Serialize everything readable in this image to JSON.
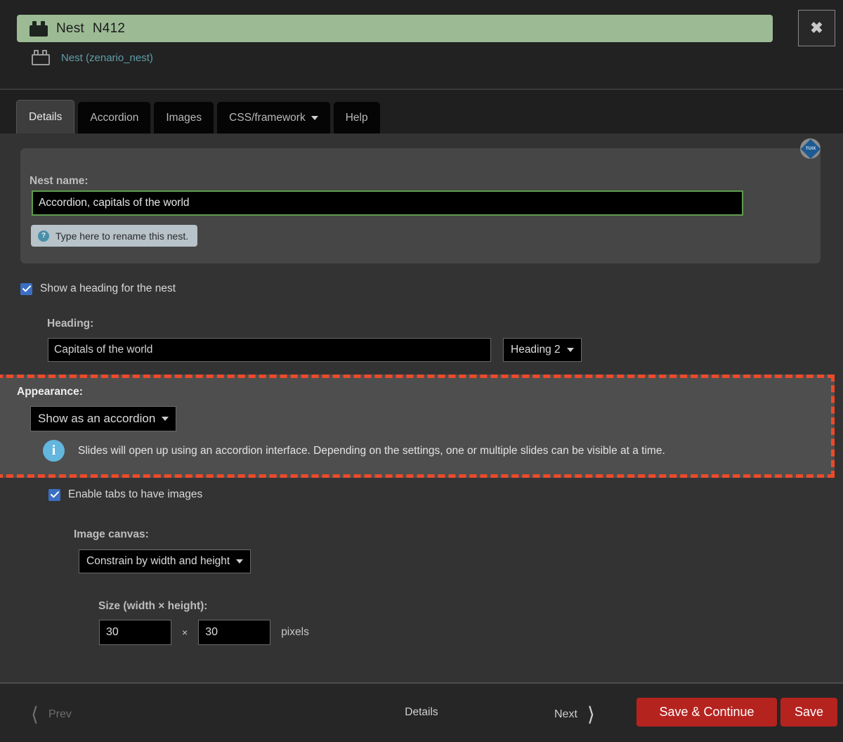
{
  "window": {
    "drag_handle": "drag-handle",
    "title": "Nest",
    "title_code": "N412",
    "close_label": "✖",
    "subtitle": "Nest (zenario_nest)"
  },
  "tabs": [
    {
      "label": "Details",
      "active": true,
      "has_caret": false
    },
    {
      "label": "Accordion",
      "active": false,
      "has_caret": false
    },
    {
      "label": "Images",
      "active": false,
      "has_caret": false
    },
    {
      "label": "CSS/framework",
      "active": false,
      "has_caret": true
    },
    {
      "label": "Help",
      "active": false,
      "has_caret": false
    }
  ],
  "panel": {
    "badge_text": "TUIX",
    "nest_name_label": "Nest name:",
    "nest_name_value": "Accordion, capitals of the world",
    "nest_name_placeholder": "Nest name",
    "tooltip_icon": "question-icon",
    "tooltip_text": "Type here to rename this nest."
  },
  "heading_section": {
    "show_heading_label": "Show a heading for the nest",
    "show_heading_checked": true,
    "heading_label": "Heading:",
    "heading_value": "Capitals of the world",
    "heading_placeholder": "Heading",
    "heading_level_value": "Heading 2"
  },
  "appearance": {
    "label": "Appearance:",
    "select_value": "Show as an accordion",
    "info_icon": "info-icon",
    "info_text": "Slides will open up using an accordion interface. Depending on the settings, one or multiple slides can be visible at a time.",
    "highlight_color": "#ec4a2a"
  },
  "images_section": {
    "enable_tabs_label": "Enable tabs to have images",
    "enable_tabs_checked": true,
    "canvas_label": "Image canvas:",
    "canvas_value": "Constrain by width and height",
    "size_label": "Size (width × height):",
    "size_width": "30",
    "size_height": "30",
    "size_times": "×",
    "size_units": "pixels"
  },
  "footer": {
    "prev_label": "Prev",
    "center_label": "Details",
    "next_label": "Next",
    "save_continue_label": "Save & Continue",
    "save_label": "Save",
    "button_color": "#b5231f"
  }
}
